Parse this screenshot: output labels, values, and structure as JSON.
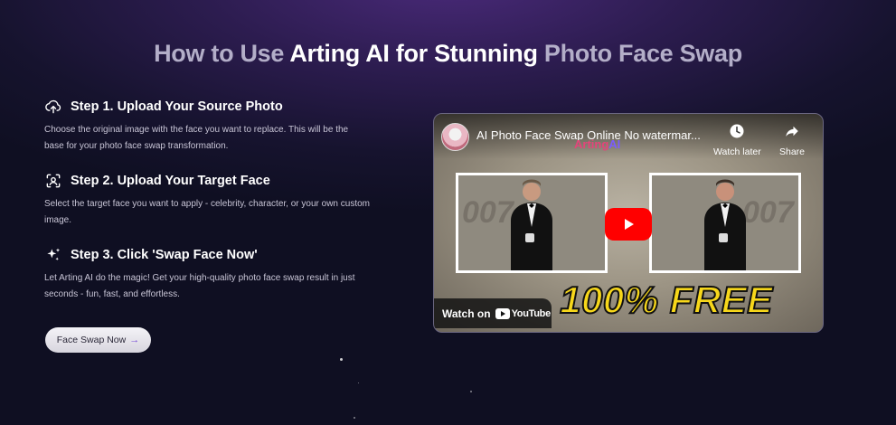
{
  "heading": {
    "part1": "How to Use ",
    "part2": "Arting AI for Stunning ",
    "part3": "Photo Face Swap"
  },
  "steps": [
    {
      "icon": "cloud-upload-icon",
      "title": "Step 1. Upload Your Source Photo",
      "description": "Choose the original image with the face you want to replace. This will be the base for your photo face swap transformation."
    },
    {
      "icon": "face-scan-icon",
      "title": "Step 2. Upload Your Target Face",
      "description": "Select the target face you want to apply - celebrity, character, or your own custom image."
    },
    {
      "icon": "sparkles-icon",
      "title": "Step 3. Click 'Swap Face Now'",
      "description": "Let Arting AI do the magic! Get your high-quality photo face swap result in just seconds - fun, fast, and effortless."
    }
  ],
  "cta": {
    "label": "Face Swap Now",
    "arrow": "→"
  },
  "video": {
    "title": "AI Photo Face Swap Online No watermar...",
    "brand_mark_left": "Arting",
    "brand_mark_right": "AI",
    "watch_later_label": "Watch later",
    "share_label": "Share",
    "watermark_text": "007",
    "banner_text": "100% FREE",
    "watch_on_label": "Watch on",
    "youtube_label": "YouTube"
  },
  "colors": {
    "accent_purple": "#7a4fd8",
    "youtube_red": "#ff0000",
    "banner_yellow": "#f7d71a"
  }
}
